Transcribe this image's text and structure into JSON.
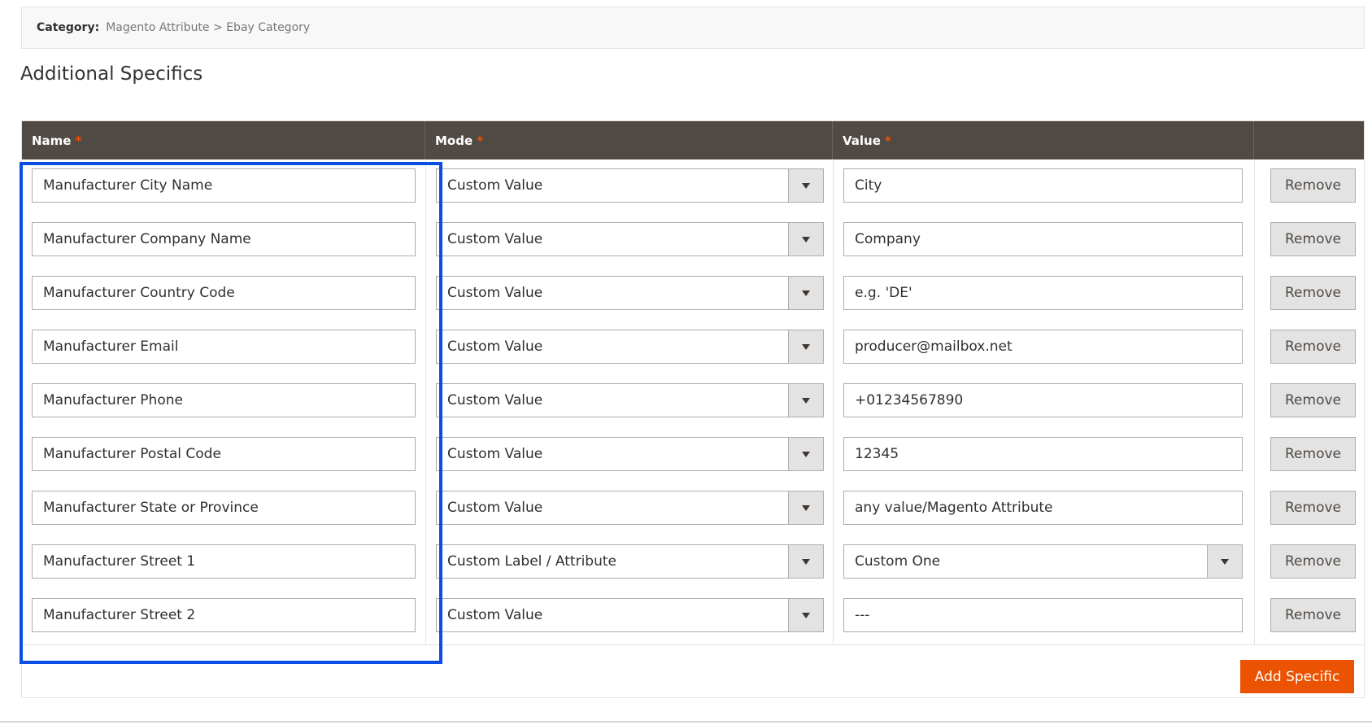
{
  "category": {
    "label": "Category:",
    "path": "Magento Attribute > Ebay Category"
  },
  "section_title": "Additional Specifics",
  "columns": {
    "name": "Name",
    "mode": "Mode",
    "value": "Value",
    "required_mark": "*"
  },
  "rows": [
    {
      "name": "Manufacturer City Name",
      "mode": "Custom Value",
      "value": "City",
      "value_is_select": false
    },
    {
      "name": "Manufacturer Company Name",
      "mode": "Custom Value",
      "value": "Company",
      "value_is_select": false
    },
    {
      "name": "Manufacturer Country Code",
      "mode": "Custom Value",
      "value": "e.g. 'DE'",
      "value_is_select": false
    },
    {
      "name": "Manufacturer Email",
      "mode": "Custom Value",
      "value": "producer@mailbox.net",
      "value_is_select": false
    },
    {
      "name": "Manufacturer Phone",
      "mode": "Custom Value",
      "value": "+01234567890",
      "value_is_select": false
    },
    {
      "name": "Manufacturer Postal Code",
      "mode": "Custom Value",
      "value": "12345",
      "value_is_select": false
    },
    {
      "name": "Manufacturer State or Province",
      "mode": "Custom Value",
      "value": "any value/Magento Attribute",
      "value_is_select": false
    },
    {
      "name": "Manufacturer Street 1",
      "mode": "Custom Label / Attribute",
      "value": "Custom One",
      "value_is_select": true
    },
    {
      "name": "Manufacturer Street 2",
      "mode": "Custom Value",
      "value": "---",
      "value_is_select": false
    }
  ],
  "remove_label": "Remove",
  "add_label": "Add Specific",
  "colors": {
    "header_bg": "#514943",
    "accent": "#eb5202",
    "highlight": "#0a4de5"
  }
}
